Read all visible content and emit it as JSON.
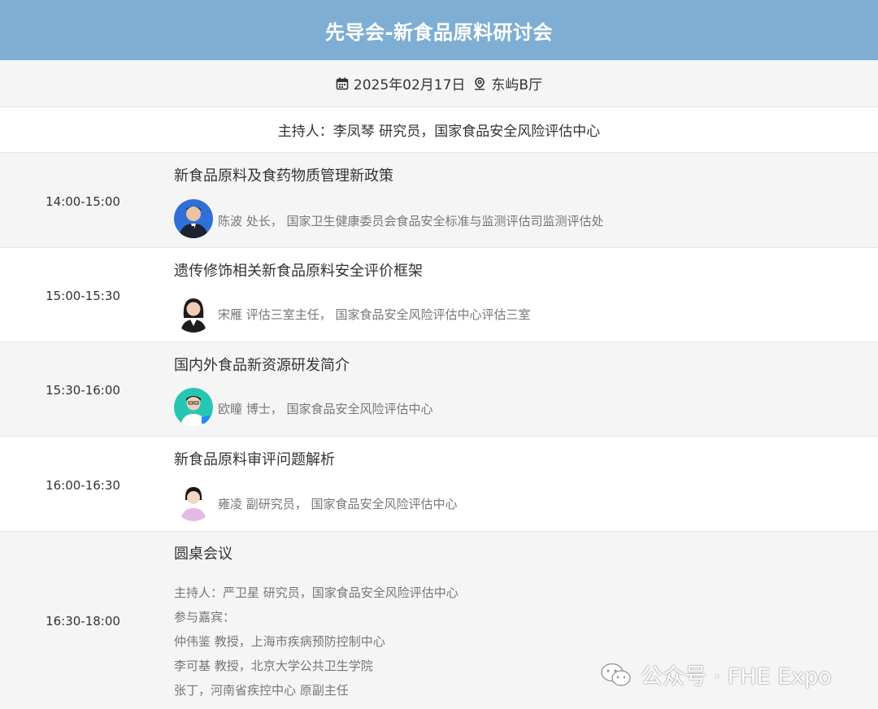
{
  "header": {
    "title": "先导会-新食品原料研讨会"
  },
  "info": {
    "date": "2025年02月17日",
    "location": "东屿B厅",
    "date_icon": "calendar-icon",
    "location_icon": "location-pin-icon"
  },
  "host": {
    "text": "主持人：李凤琴 研究员，国家食品安全风险评估中心"
  },
  "sessions": [
    {
      "time": "14:00-15:00",
      "title": "新食品原料及食药物质管理新政策",
      "speaker": "陈波 处长， 国家卫生健康委员会食品安全标准与监测评估司监测评估处"
    },
    {
      "time": "15:00-15:30",
      "title": "遗传修饰相关新食品原料安全评价框架",
      "speaker": "宋雁 评估三室主任， 国家食品安全风险评估中心评估三室"
    },
    {
      "time": "15:30-16:00",
      "title": "国内外食品新资源研发简介",
      "speaker": "欧瞳 博士， 国家食品安全风险评估中心"
    },
    {
      "time": "16:00-16:30",
      "title": "新食品原料审评问题解析",
      "speaker": "雍凌 副研究员， 国家食品安全风险评估中心"
    }
  ],
  "roundtable": {
    "time": "16:30-18:00",
    "title": "圆桌会议",
    "lines": [
      "主持人：严卫星 研究员，国家食品安全风险评估中心",
      "参与嘉宾：",
      "仲伟鉴 教授，上海市疾病预防控制中心",
      "李可基 教授，北京大学公共卫生学院",
      "张丁，河南省疾控中心 原副主任"
    ]
  },
  "watermark": {
    "text": "公众号 · FHE Expo",
    "icon": "wechat-icon"
  }
}
